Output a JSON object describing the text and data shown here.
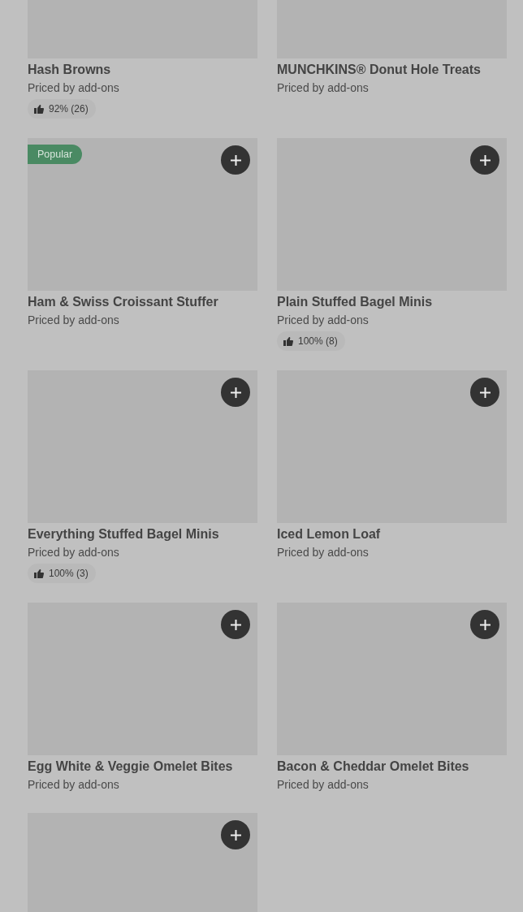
{
  "items": [
    {
      "name": "Hash Browns",
      "price": "Priced by add-ons",
      "rating": "92% (26)",
      "add_button": false
    },
    {
      "name": "MUNCHKINS® Donut Hole Treats",
      "price": "Priced by add-ons",
      "add_button": false
    },
    {
      "name": "Ham & Swiss Croissant Stuffer",
      "price": "Priced by add-ons",
      "badge": "Popular",
      "add_button": true
    },
    {
      "name": "Plain Stuffed Bagel Minis",
      "price": "Priced by add-ons",
      "rating": "100% (8)",
      "add_button": true
    },
    {
      "name": "Everything Stuffed Bagel Minis",
      "price": "Priced by add-ons",
      "rating": "100% (3)",
      "add_button": true
    },
    {
      "name": "Iced Lemon Loaf",
      "price": "Priced by add-ons",
      "add_button": true
    },
    {
      "name": "Egg White & Veggie Omelet Bites",
      "price": "Priced by add-ons",
      "add_button": true
    },
    {
      "name": "Bacon & Cheddar Omelet Bites",
      "price": "Priced by add-ons",
      "add_button": true
    },
    {
      "add_button": true
    }
  ]
}
